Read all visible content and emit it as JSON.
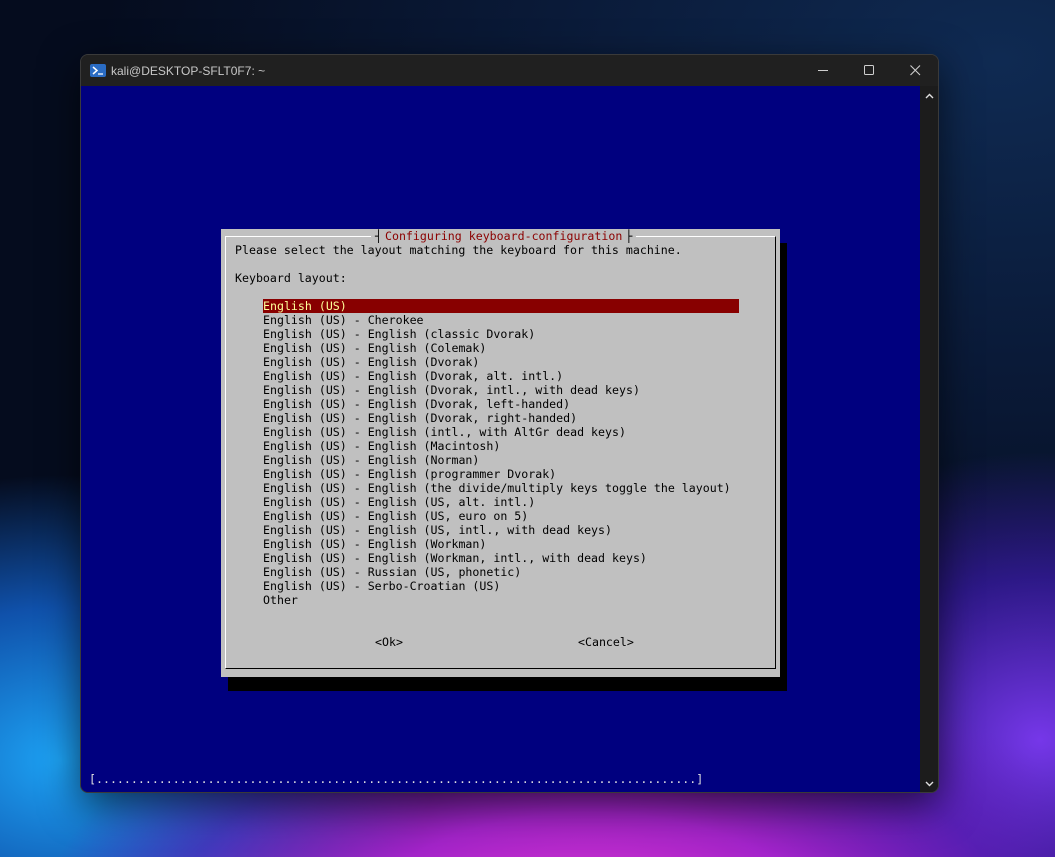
{
  "window": {
    "title": "kali@DESKTOP-SFLT0F7: ~",
    "minimize_glyph": "—",
    "maximize_glyph": "☐",
    "close_glyph": "✕"
  },
  "scrollbar": {
    "up_glyph": "▲",
    "down_glyph": "▼"
  },
  "dialog": {
    "left_bracket": "┤",
    "right_bracket": "├",
    "title": "Configuring keyboard-configuration",
    "prompt": "Please select the layout matching the keyboard for this machine.",
    "label": "Keyboard layout:",
    "items": [
      {
        "label": "English (US)",
        "selected": true
      },
      {
        "label": "English (US) - Cherokee",
        "selected": false
      },
      {
        "label": "English (US) - English (classic Dvorak)",
        "selected": false
      },
      {
        "label": "English (US) - English (Colemak)",
        "selected": false
      },
      {
        "label": "English (US) - English (Dvorak)",
        "selected": false
      },
      {
        "label": "English (US) - English (Dvorak, alt. intl.)",
        "selected": false
      },
      {
        "label": "English (US) - English (Dvorak, intl., with dead keys)",
        "selected": false
      },
      {
        "label": "English (US) - English (Dvorak, left-handed)",
        "selected": false
      },
      {
        "label": "English (US) - English (Dvorak, right-handed)",
        "selected": false
      },
      {
        "label": "English (US) - English (intl., with AltGr dead keys)",
        "selected": false
      },
      {
        "label": "English (US) - English (Macintosh)",
        "selected": false
      },
      {
        "label": "English (US) - English (Norman)",
        "selected": false
      },
      {
        "label": "English (US) - English (programmer Dvorak)",
        "selected": false
      },
      {
        "label": "English (US) - English (the divide/multiply keys toggle the layout)",
        "selected": false
      },
      {
        "label": "English (US) - English (US, alt. intl.)",
        "selected": false
      },
      {
        "label": "English (US) - English (US, euro on 5)",
        "selected": false
      },
      {
        "label": "English (US) - English (US, intl., with dead keys)",
        "selected": false
      },
      {
        "label": "English (US) - English (Workman)",
        "selected": false
      },
      {
        "label": "English (US) - English (Workman, intl., with dead keys)",
        "selected": false
      },
      {
        "label": "English (US) - Russian (US, phonetic)",
        "selected": false
      },
      {
        "label": "English (US) - Serbo-Croatian (US)",
        "selected": false
      },
      {
        "label": "Other",
        "selected": false
      }
    ],
    "ok_label": "<Ok>",
    "cancel_label": "<Cancel>"
  },
  "status_line": "[......................................................................................]",
  "colors": {
    "terminal_bg": "#00007f",
    "dialog_bg": "#c0c0c0",
    "selection_bg": "#880000",
    "selection_fg": "#ffff99",
    "title_fg": "#8b0000"
  }
}
